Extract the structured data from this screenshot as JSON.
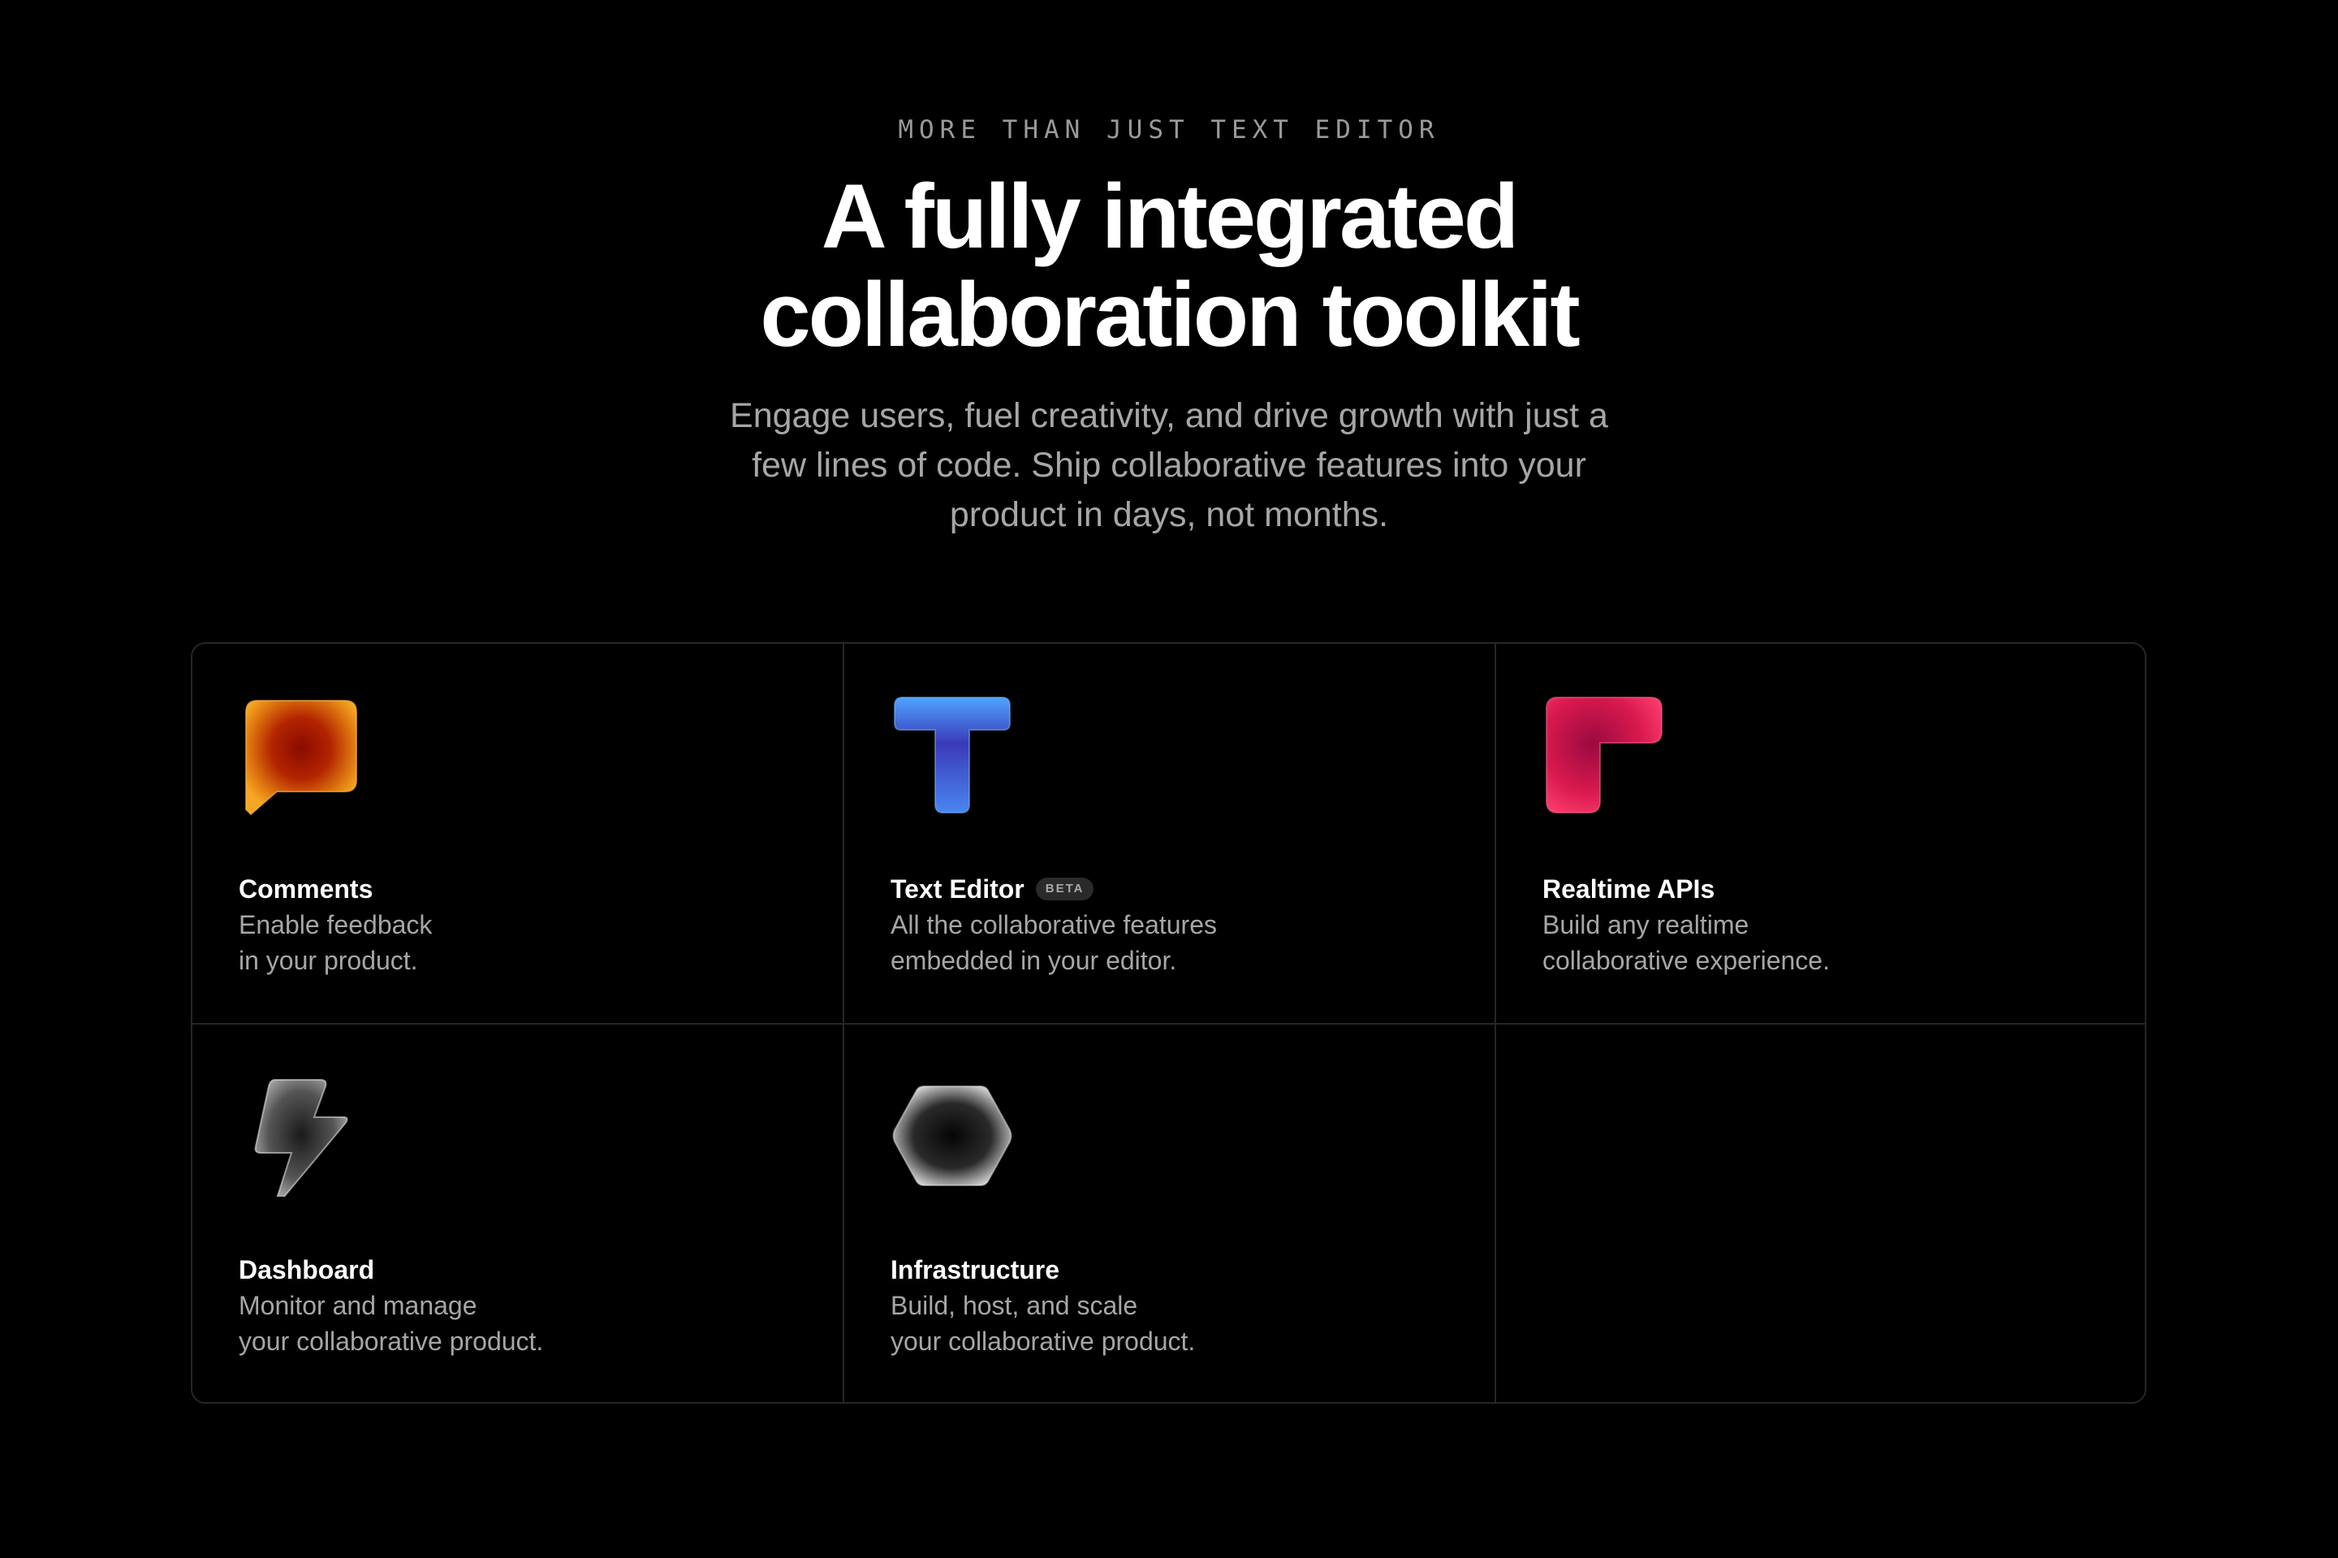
{
  "hero": {
    "eyebrow": "MORE THAN JUST TEXT EDITOR",
    "title_line1": "A fully integrated",
    "title_line2": "collaboration toolkit",
    "subtitle_line1": "Engage users, fuel creativity, and drive growth with just a",
    "subtitle_line2": "few lines of code. Ship collaborative features into your",
    "subtitle_line3": "product in days, not months."
  },
  "features": [
    {
      "title": "Comments",
      "badge": "",
      "desc_line1": "Enable feedback",
      "desc_line2": "in your product.",
      "icon": "speech-bubble-icon"
    },
    {
      "title": "Text Editor",
      "badge": "BETA",
      "desc_line1": "All the collaborative features",
      "desc_line2": "embedded in your editor.",
      "icon": "letter-t-icon"
    },
    {
      "title": "Realtime APIs",
      "badge": "",
      "desc_line1": "Build any realtime",
      "desc_line2": "collaborative experience.",
      "icon": "corner-bracket-icon"
    },
    {
      "title": "Dashboard",
      "badge": "",
      "desc_line1": "Monitor and manage",
      "desc_line2": "your collaborative product.",
      "icon": "lightning-bolt-icon"
    },
    {
      "title": "Infrastructure",
      "badge": "",
      "desc_line1": "Build, host, and scale",
      "desc_line2": "your collaborative product.",
      "icon": "hexagon-icon"
    }
  ],
  "colors": {
    "background": "#000000",
    "border": "#262626",
    "muted_text": "#a6a6a6",
    "comments_orange": "#f5a623",
    "comments_red": "#a01800",
    "editor_blue": "#4a8cf5",
    "editor_indigo": "#2a2a9a",
    "realtime_pink": "#ff2e6a",
    "realtime_crimson": "#a0103c"
  }
}
